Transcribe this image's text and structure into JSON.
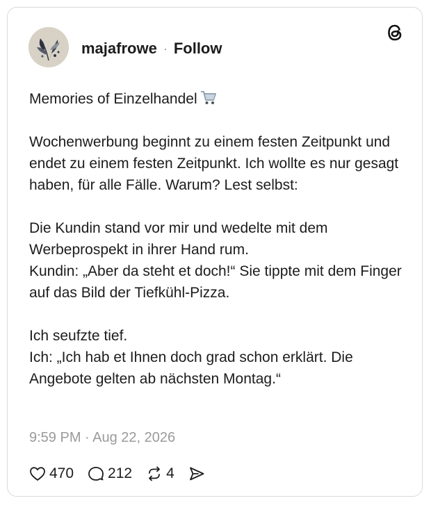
{
  "post": {
    "username": "majafrowe",
    "separator": "·",
    "follow_label": "Follow",
    "title_line": "Memories of Einzelhandel",
    "paragraphs": [
      "Wochenwerbung beginnt zu einem festen Zeitpunkt und endet zu einem festen Zeitpunkt. Ich wollte es nur gesagt haben, für alle Fälle. Warum? Lest selbst:",
      "Die Kundin stand vor mir und wedelte mit dem Werbeprospekt in ihrer Hand rum.\nKundin: „Aber da steht et doch!“ Sie tippte mit dem Finger auf das Bild der Tiefkühl-Pizza.",
      "Ich seufzte tief.\nIch: „Ich hab et Ihnen doch grad schon erklärt. Die Angebote gelten ab nächsten Montag.“"
    ],
    "timestamp": "9:59 PM · Aug 22, 2026"
  },
  "actions": {
    "likes": "470",
    "replies": "212",
    "reposts": "4"
  },
  "icons": {
    "logo": "threads-logo-icon",
    "emoji": "shopping-cart-icon",
    "like": "heart-icon",
    "reply": "comment-icon",
    "repost": "repost-icon",
    "share": "send-icon"
  },
  "colors": {
    "text": "#1c1c1c",
    "muted": "#9a9a9a",
    "border": "#d9d9d9"
  }
}
